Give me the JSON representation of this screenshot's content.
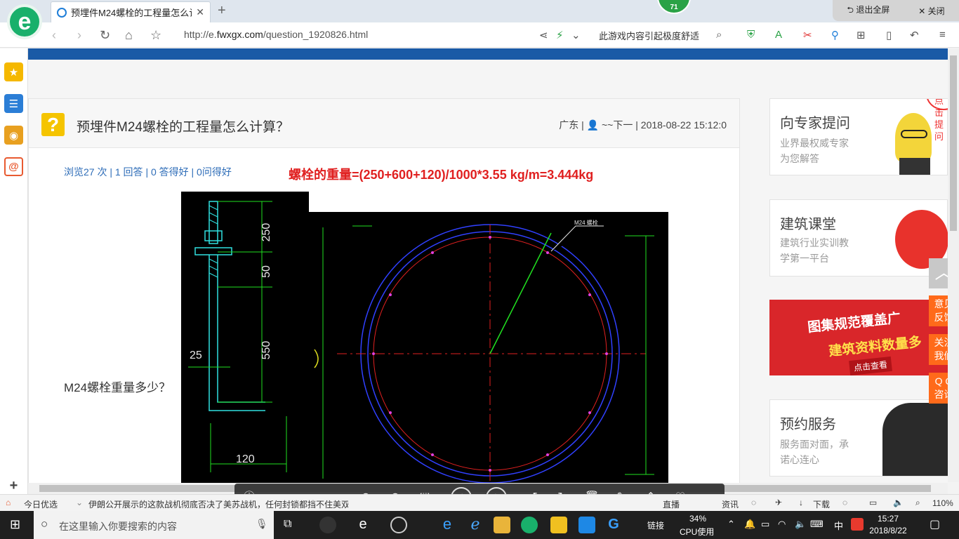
{
  "browser": {
    "tab_title": "预埋件M24螺栓的工程量怎么计算？",
    "badge": "71",
    "exit_fullscreen": "退出全屏",
    "close": "关闭",
    "url_prefix": "http://e.",
    "url_domain": "fwxgx.com",
    "url_path": "/question_1920826.html",
    "search_text": "此游戏内容引起极度舒适"
  },
  "question": {
    "title": "预埋件M24螺栓的工程量怎么计算？",
    "region": "广东",
    "user": "~~下一",
    "datetime": "2018-08-22 15:12:0",
    "stats": "浏览27 次 | 1 回答 | 0 答得好 | 0问得好",
    "answer_formula": "螺栓的重量=(250+600+120)/1000*3.55  kg/m=3.444kg",
    "body": "M24螺栓重量多少？",
    "dims": {
      "d250": "250",
      "d50": "50",
      "d550": "550",
      "d25": "25",
      "d120": "120"
    },
    "cad_note": "M24 螺栓"
  },
  "sidebar_right": {
    "expert": {
      "title": "向专家提问",
      "sub1": "业界最权威专家",
      "sub2": "为您解答",
      "bubble": "点击提问"
    },
    "class": {
      "title": "建筑课堂",
      "sub1": "建筑行业实训教",
      "sub2": "学第一平台"
    },
    "ad": {
      "line1": "图集规范覆盖广",
      "line2": "建筑资料数量多",
      "cta": "点击查看"
    },
    "service": {
      "title": "预约服务",
      "sub1": "服务面对面，承",
      "sub2": "诺心连心"
    }
  },
  "float_buttons": {
    "feedback": "意见\n反馈",
    "follow": "关注\n我们",
    "qq": "Q Q\n咨询"
  },
  "viewer": {
    "ratio": "1:1"
  },
  "statusbar": {
    "today": "今日优选",
    "news": "伊朗公开展示的这款战机彻底否决了美苏战机，任何封锁都挡不住美双",
    "live": "直播",
    "hotnews": "资讯",
    "download": "下载",
    "zoom": "110%"
  },
  "taskbar": {
    "search_placeholder": "在这里输入你要搜索的内容",
    "link": "链接",
    "cpu_percent": "34%",
    "cpu_label": "CPU使用",
    "ime": "中",
    "time": "15:27",
    "date": "2018/8/22"
  }
}
